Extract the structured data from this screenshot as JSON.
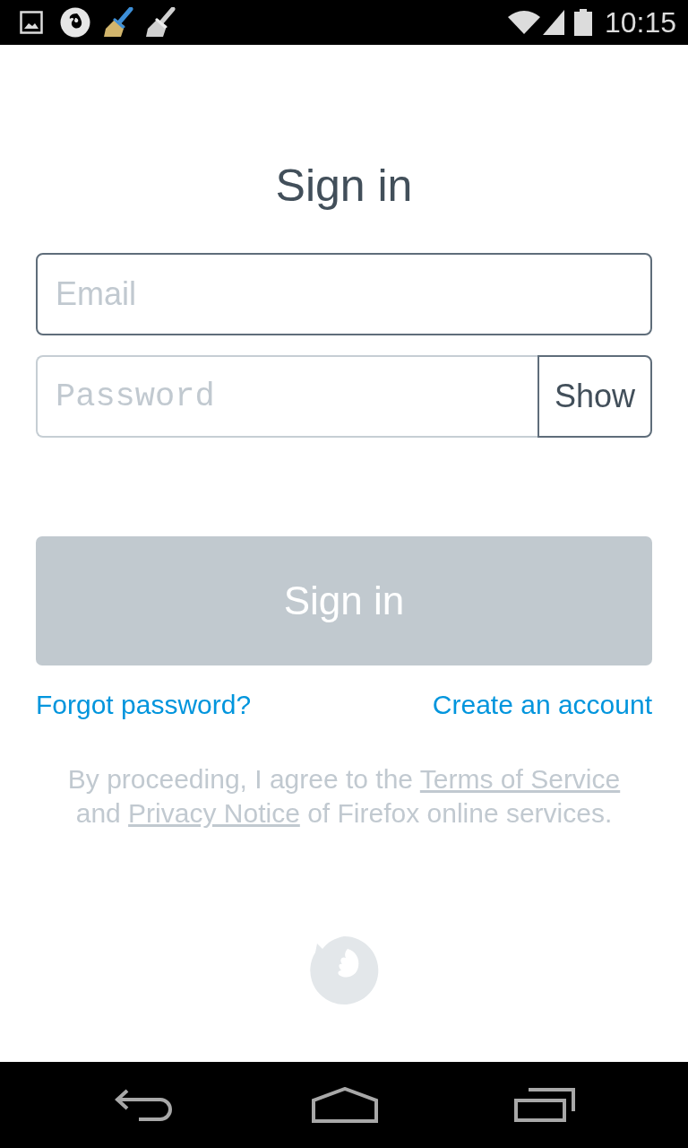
{
  "status_bar": {
    "time": "10:15"
  },
  "title": "Sign in",
  "fields": [
    {
      "kind": "email",
      "placeholder": "Email",
      "focused": true
    },
    {
      "kind": "password",
      "placeholder": "Password",
      "focused": false,
      "toggle": "Show"
    }
  ],
  "submit": {
    "label": "Sign in",
    "disabled": true
  },
  "links": [
    "Forgot password?",
    "Create an account"
  ],
  "legal": {
    "parts": [
      {
        "kind": "text",
        "text": "By proceeding, I agree to the "
      },
      {
        "kind": "link",
        "text": "Terms of Service"
      },
      {
        "kind": "text",
        "text": " and "
      },
      {
        "kind": "link",
        "text": "Privacy Notice"
      },
      {
        "kind": "text",
        "text": " of Firefox online services."
      }
    ]
  }
}
